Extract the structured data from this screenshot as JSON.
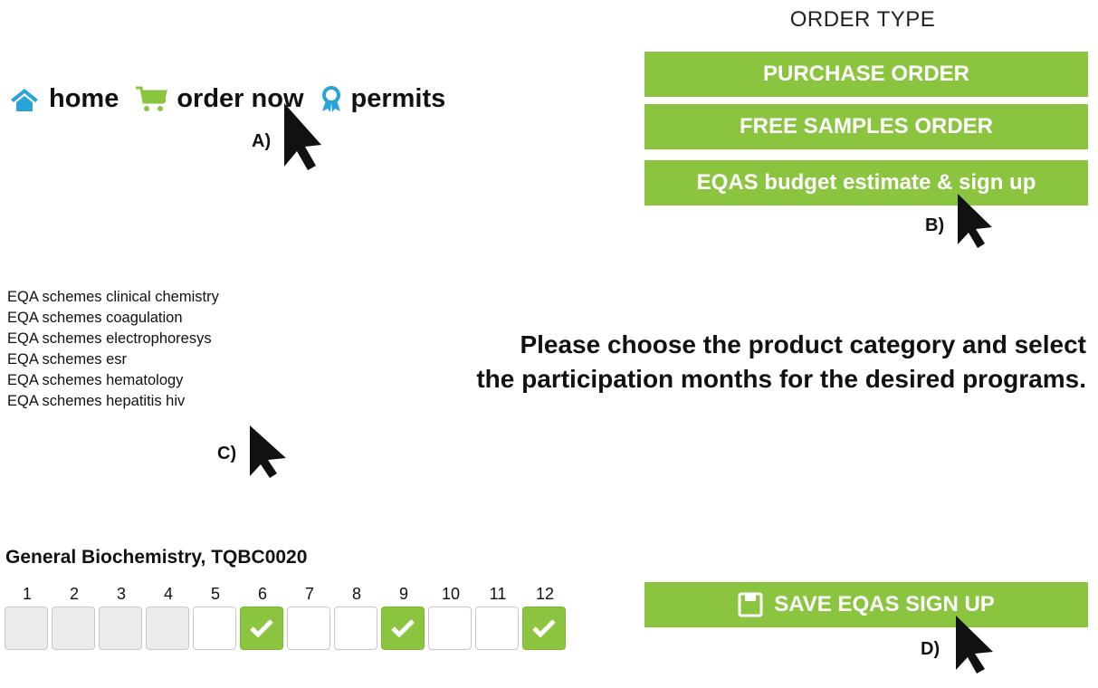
{
  "nav": {
    "items": [
      {
        "label": "home",
        "icon": "home-icon",
        "color": "#2aa3d9"
      },
      {
        "label": "order now",
        "icon": "cart-icon",
        "color": "#8bc53f"
      },
      {
        "label": "permits",
        "icon": "award-ribbon-icon",
        "color": "#2aa3d9"
      }
    ]
  },
  "order_type": {
    "title": "ORDER TYPE",
    "buttons": [
      "PURCHASE ORDER",
      "FREE SAMPLES ORDER",
      "EQAS budget estimate & sign up"
    ]
  },
  "markers": {
    "a": "A)",
    "b": "B)",
    "c": "C)",
    "d": "D)"
  },
  "categories": [
    "EQA schemes clinical chemistry",
    "EQA schemes coagulation",
    "EQA schemes electrophoresys",
    "EQA schemes esr",
    "EQA schemes hematology",
    "EQA schemes hepatitis hiv"
  ],
  "instruction": {
    "line1": "Please choose the product category and select",
    "line2": "the participation months for the desired programs."
  },
  "program": {
    "title": "General Biochemistry, TQBC0020",
    "months": [
      {
        "num": "1",
        "state": "disabled"
      },
      {
        "num": "2",
        "state": "disabled"
      },
      {
        "num": "3",
        "state": "disabled"
      },
      {
        "num": "4",
        "state": "disabled"
      },
      {
        "num": "5",
        "state": "empty"
      },
      {
        "num": "6",
        "state": "checked"
      },
      {
        "num": "7",
        "state": "empty"
      },
      {
        "num": "8",
        "state": "empty"
      },
      {
        "num": "9",
        "state": "checked"
      },
      {
        "num": "10",
        "state": "empty"
      },
      {
        "num": "11",
        "state": "empty"
      },
      {
        "num": "12",
        "state": "checked"
      }
    ]
  },
  "save": {
    "label": "SAVE EQAS SIGN UP",
    "icon": "save-icon"
  },
  "colors": {
    "accent": "#8bc53f",
    "nav_blue": "#2aa3d9"
  }
}
